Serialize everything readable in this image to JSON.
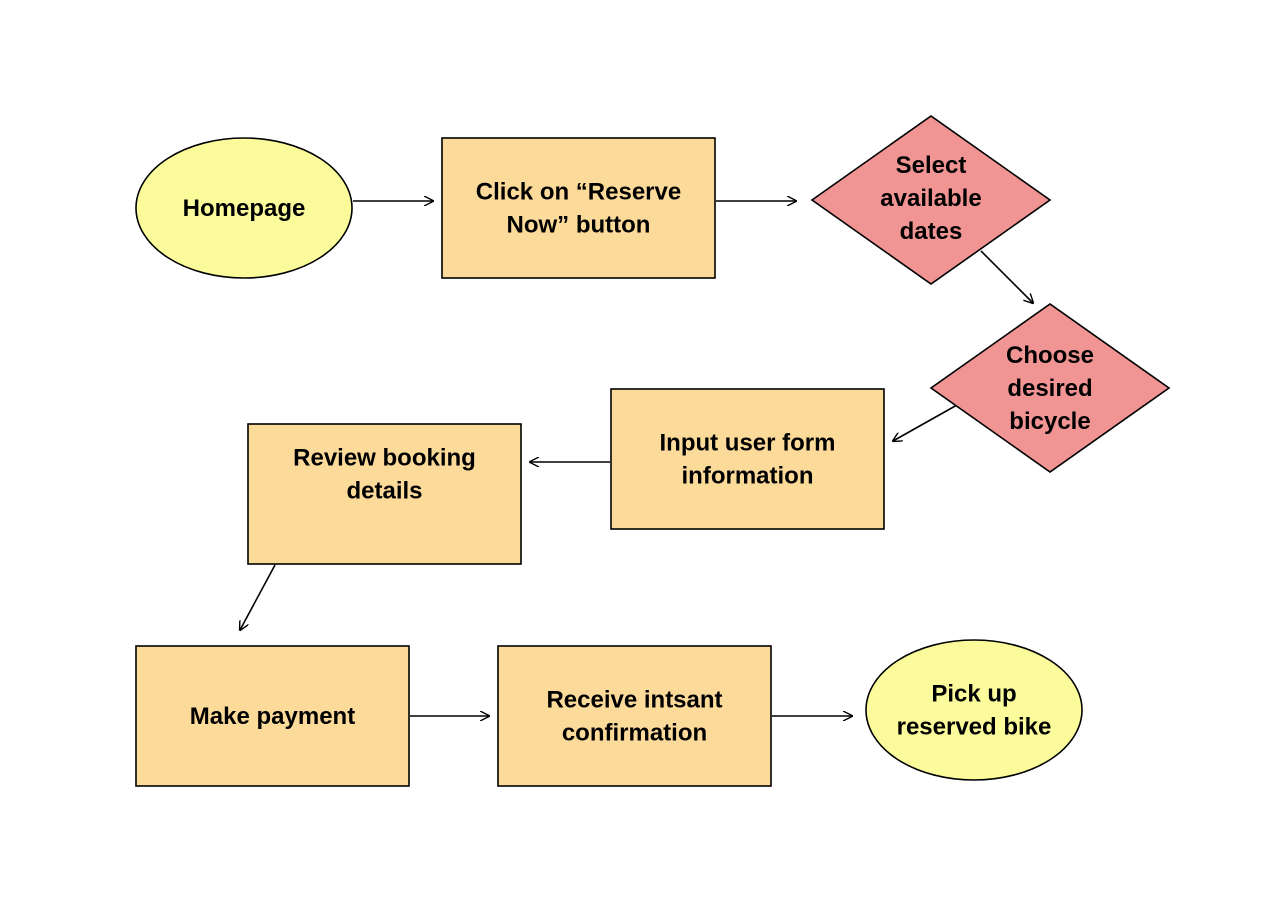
{
  "colors": {
    "terminal": "#fbfb9b",
    "process": "#fcda9a",
    "decision": "#f09494",
    "stroke": "#000000"
  },
  "nodes": [
    {
      "id": "homepage",
      "shape": "ellipse",
      "lines": [
        "Homepage"
      ]
    },
    {
      "id": "reserve",
      "shape": "rect",
      "lines": [
        "Click on “Reserve",
        "Now” button"
      ]
    },
    {
      "id": "dates",
      "shape": "diamond",
      "lines": [
        "Select",
        "available",
        "dates"
      ]
    },
    {
      "id": "bicycle",
      "shape": "diamond",
      "lines": [
        "Choose",
        "desired",
        "bicycle"
      ]
    },
    {
      "id": "input",
      "shape": "rect",
      "lines": [
        "Input user form",
        "information"
      ]
    },
    {
      "id": "review",
      "shape": "rect",
      "lines": [
        "Review booking",
        "details"
      ]
    },
    {
      "id": "payment",
      "shape": "rect",
      "lines": [
        "Make payment"
      ]
    },
    {
      "id": "confirm",
      "shape": "rect",
      "lines": [
        "Receive intsant",
        "confirmation"
      ]
    },
    {
      "id": "pickup",
      "shape": "ellipse",
      "lines": [
        "Pick up",
        "reserved bike"
      ]
    }
  ],
  "edges": [
    [
      "homepage",
      "reserve"
    ],
    [
      "reserve",
      "dates"
    ],
    [
      "dates",
      "bicycle"
    ],
    [
      "bicycle",
      "input"
    ],
    [
      "input",
      "review"
    ],
    [
      "review",
      "payment"
    ],
    [
      "payment",
      "confirm"
    ],
    [
      "confirm",
      "pickup"
    ]
  ]
}
